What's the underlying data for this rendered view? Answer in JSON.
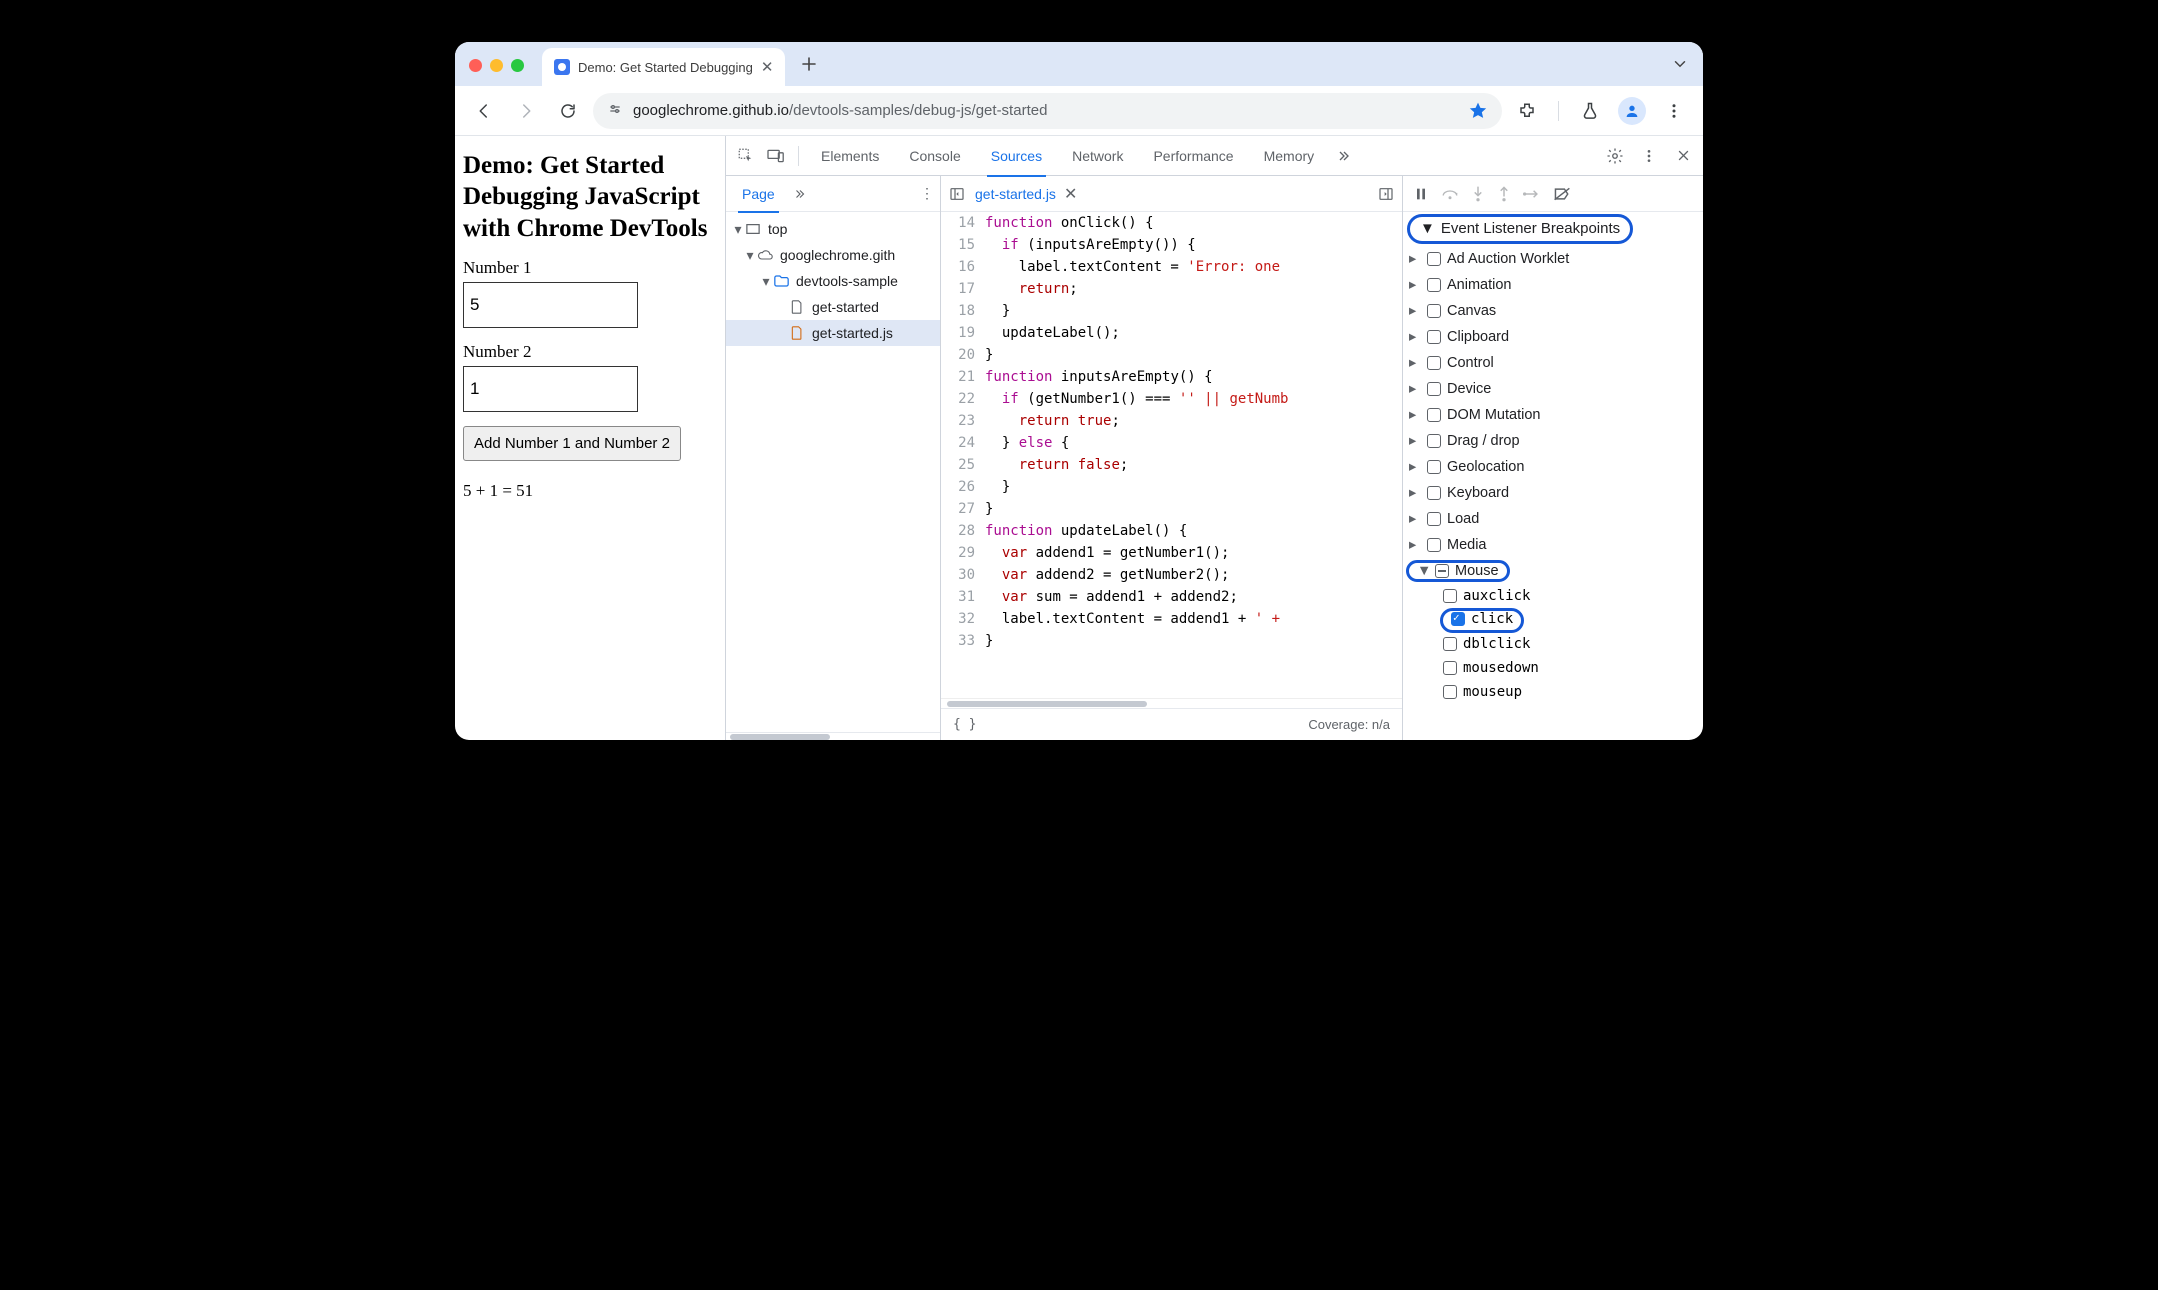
{
  "browser": {
    "tab_title": "Demo: Get Started Debugging",
    "url_host": "googlechrome.github.io",
    "url_path": "/devtools-samples/debug-js/get-started"
  },
  "page": {
    "heading": "Demo: Get Started Debugging JavaScript with Chrome DevTools",
    "label1": "Number 1",
    "val1": "5",
    "label2": "Number 2",
    "val2": "1",
    "button": "Add Number 1 and Number 2",
    "result": "5 + 1 = 51"
  },
  "devtools": {
    "tabs": [
      "Elements",
      "Console",
      "Sources",
      "Network",
      "Performance",
      "Memory"
    ],
    "active_tab": "Sources",
    "nav": {
      "page_tab": "Page",
      "tree": {
        "top": "top",
        "domain": "googlechrome.gith",
        "folder": "devtools-sample",
        "file_html": "get-started",
        "file_js": "get-started.js"
      }
    },
    "editor": {
      "file_tab": "get-started.js",
      "first_line": 14,
      "lines": [
        "function onClick() {",
        "  if (inputsAreEmpty()) {",
        "    label.textContent = 'Error: one",
        "    return;",
        "  }",
        "  updateLabel();",
        "}",
        "function inputsAreEmpty() {",
        "  if (getNumber1() === '' || getNumb",
        "    return true;",
        "  } else {",
        "    return false;",
        "  }",
        "}",
        "function updateLabel() {",
        "  var addend1 = getNumber1();",
        "  var addend2 = getNumber2();",
        "  var sum = addend1 + addend2;",
        "  label.textContent = addend1 + ' +",
        "}"
      ],
      "coverage": "Coverage: n/a"
    },
    "debugger": {
      "section_title": "Event Listener Breakpoints",
      "categories": [
        {
          "name": "Ad Auction Worklet"
        },
        {
          "name": "Animation"
        },
        {
          "name": "Canvas"
        },
        {
          "name": "Clipboard"
        },
        {
          "name": "Control"
        },
        {
          "name": "Device"
        },
        {
          "name": "DOM Mutation"
        },
        {
          "name": "Drag / drop"
        },
        {
          "name": "Geolocation"
        },
        {
          "name": "Keyboard"
        },
        {
          "name": "Load"
        },
        {
          "name": "Media"
        }
      ],
      "mouse": {
        "name": "Mouse",
        "events": [
          {
            "name": "auxclick",
            "checked": false
          },
          {
            "name": "click",
            "checked": true
          },
          {
            "name": "dblclick",
            "checked": false
          },
          {
            "name": "mousedown",
            "checked": false
          },
          {
            "name": "mouseup",
            "checked": false
          }
        ]
      }
    }
  }
}
